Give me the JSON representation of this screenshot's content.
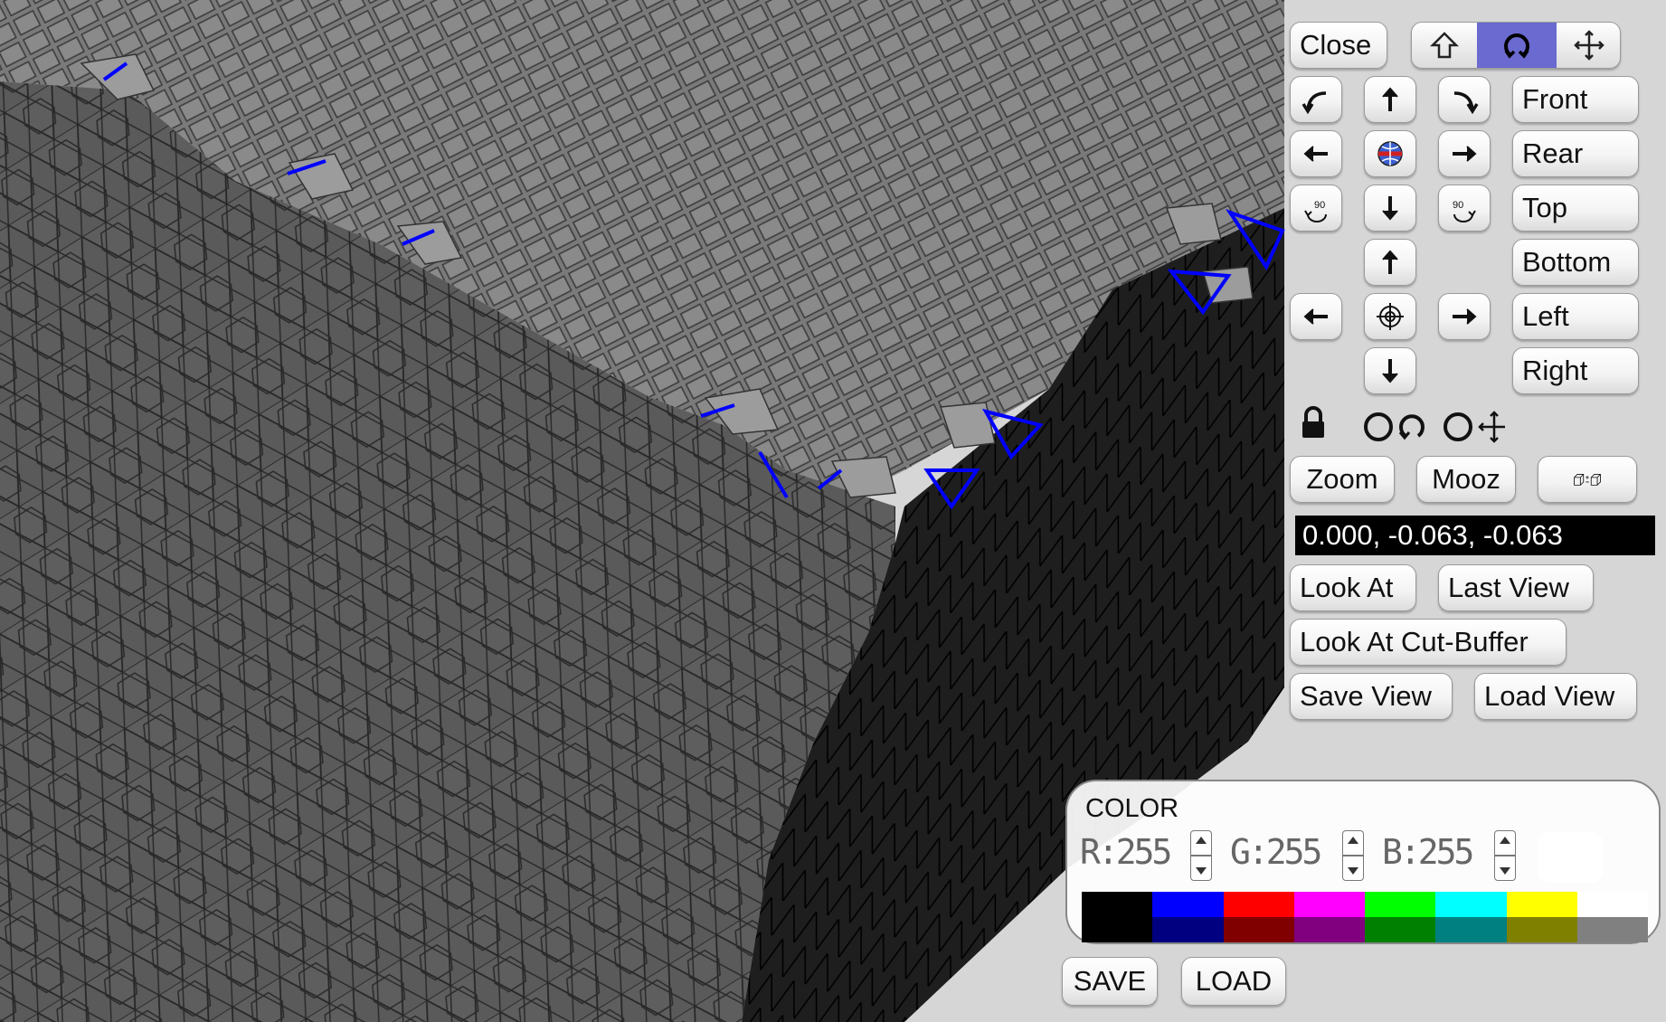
{
  "toolbar": {
    "close_label": "Close",
    "mode_icons": [
      "home-up-icon",
      "rotate-icon",
      "move-icon"
    ],
    "active_mode": "rotate"
  },
  "nav": {
    "views": [
      "Front",
      "Rear",
      "Top",
      "Bottom",
      "Left",
      "Right"
    ],
    "rotate_90_label": "90"
  },
  "zoom": {
    "zoom_label": "Zoom",
    "mooz_label": "Mooz"
  },
  "coordinates": "0.000, -0.063, -0.063",
  "view_buttons": {
    "look_at": "Look At",
    "last_view": "Last View",
    "look_at_cut_buffer": "Look At Cut-Buffer",
    "save_view": "Save View",
    "load_view": "Load View"
  },
  "color": {
    "title": "COLOR",
    "r_label": "R:255",
    "g_label": "G:255",
    "b_label": "B:255",
    "current": "#ffffff",
    "palette_top": [
      "#000000",
      "#0000ff",
      "#ff0000",
      "#ff00ff",
      "#00ff00",
      "#00ffff",
      "#ffff00",
      "#ffffff"
    ],
    "palette_bottom": [
      "#000000",
      "#000080",
      "#800000",
      "#800080",
      "#008000",
      "#008080",
      "#808000",
      "#808080"
    ]
  },
  "file": {
    "save_label": "SAVE",
    "load_label": "LOAD"
  },
  "colors": {
    "active_mode_bg": "#6a6ad0",
    "highlight_edges": "#0000ff"
  }
}
